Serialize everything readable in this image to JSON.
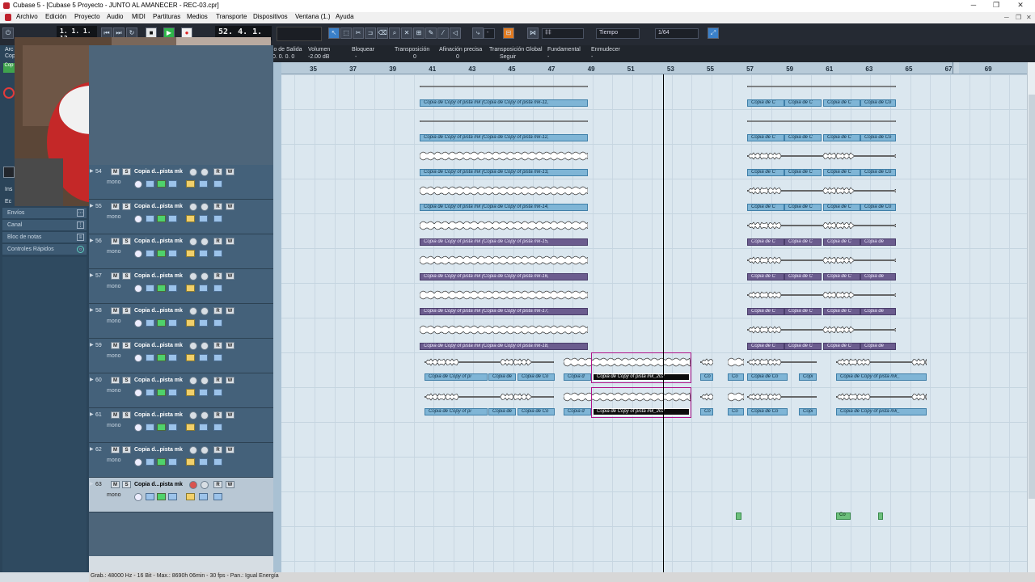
{
  "window": {
    "title": "Cubase 5 - [Cubase 5 Proyecto - JUNTO AL AMANECER - REC-03.cpr]",
    "controls": [
      "─",
      "❐",
      "✕"
    ]
  },
  "menubar": {
    "items": [
      "Archivo",
      "Edición",
      "Proyecto",
      "Audio",
      "MIDI",
      "Partituras",
      "Medios",
      "Transporte",
      "Dispositivos",
      "Ventana (1.)",
      "Ayuda"
    ]
  },
  "toolbar": {
    "position_left": "1. 1. 1. 13",
    "position_right": "52. 4. 1. 83",
    "snap_value": "Tiempo",
    "quantize": "1/64",
    "grid_glyph": "‡‡",
    "snap_dash": "-"
  },
  "infoline": {
    "labels": [
      "ido de Salida",
      "Volumen",
      "Bloquear",
      "Transposición",
      "Afinación precisa",
      "Transposición Global",
      "Fundamental",
      "Enmudecer"
    ],
    "values": [
      "0. 0. 0.   0",
      "-2.00 dB",
      "-",
      "0",
      "0",
      "Seguir",
      "-",
      "-"
    ]
  },
  "inspector": {
    "partial_labels": [
      "Arc",
      "Cop",
      "Ins",
      "Ec"
    ],
    "rows": [
      "Envíos",
      "Canal",
      "Bloc de notas",
      "Controles Rápidos"
    ]
  },
  "ruler": {
    "bars": [
      "35",
      "37",
      "39",
      "41",
      "43",
      "45",
      "47",
      "49",
      "51",
      "53",
      "55",
      "57",
      "59",
      "61",
      "63",
      "65",
      "67",
      "69"
    ]
  },
  "tracks": [
    {
      "number": "54",
      "name": "Copia d...pista mk",
      "mode": "mono",
      "mute": "M",
      "solo": "S",
      "read": "R",
      "write": "W",
      "stripe": "#2b2d3a"
    },
    {
      "number": "55",
      "name": "Copia d...pista mk",
      "mode": "mono",
      "mute": "M",
      "solo": "S",
      "read": "R",
      "write": "W",
      "stripe": "#2b2d3a"
    },
    {
      "number": "56",
      "name": "Copia d...pista mk",
      "mode": "mono",
      "mute": "M",
      "solo": "S",
      "read": "R",
      "write": "W",
      "stripe": "#2b2d3a"
    },
    {
      "number": "57",
      "name": "Copia d...pista mk",
      "mode": "mono",
      "mute": "M",
      "solo": "S",
      "read": "R",
      "write": "W",
      "stripe": "#2b2d3a"
    },
    {
      "number": "58",
      "name": "Copia d...pista mk",
      "mode": "mono",
      "mute": "M",
      "solo": "S",
      "read": "R",
      "write": "W",
      "stripe": "#62b9e6"
    },
    {
      "number": "59",
      "name": "Copia d...pista mk",
      "mode": "mono",
      "mute": "M",
      "solo": "S",
      "read": "R",
      "write": "W",
      "stripe": "#62b9e6"
    },
    {
      "number": "60",
      "name": "Copia d...pista mk",
      "mode": "mono",
      "mute": "M",
      "solo": "S",
      "read": "R",
      "write": "W",
      "stripe": "#e6d45a"
    },
    {
      "number": "61",
      "name": "Copia d...pista mk",
      "mode": "mono",
      "mute": "M",
      "solo": "S",
      "read": "R",
      "write": "W",
      "stripe": "#e6d45a"
    },
    {
      "number": "62",
      "name": "Copia d...pista mk",
      "mode": "mono",
      "mute": "M",
      "solo": "S",
      "read": "R",
      "write": "W",
      "stripe": "#5cbf7c"
    },
    {
      "number": "63",
      "name": "Copia d...pista mk",
      "mode": "mono",
      "mute": "M",
      "solo": "S",
      "read": "R",
      "write": "W",
      "stripe": "#5cbf7c"
    }
  ],
  "clips": {
    "upper_left": [
      "Copia de Copy of pista mk (Copia de Copy of pista mk-11,",
      "Copia de Copy of pista mk (Copia de Copy of pista mk-12,",
      "Copia de Copy of pista mk (Copia de Copy of pista mk-13,",
      "Copia de Copy of pista mk (Copia de Copy of pista mk-14,",
      "Copia de Copy of pista mk (Copia de Copy of pista mk-15,",
      "Copia de Copy of pista mk (Copia de Copy of pista mk-16,",
      "Copia de Copy of pista mk (Copia de Copy of pista mk-17,",
      "Copia de Copy of pista mk (Copia de Copy of pista mk-18,"
    ],
    "upper_right_blue": [
      "Copia de C",
      "Copia de C",
      "Copia de C",
      "Copia de Co"
    ],
    "upper_right_purple": [
      "Copia de C",
      "Copia de C",
      "Copia de C",
      "Copia de"
    ],
    "lane58": [
      "Copia de Copy of pi",
      "Copia de",
      "Copia de Co",
      "Copia d",
      "Copia de Copy of pista mk_202",
      "Co",
      "Co",
      "Copia de Co",
      "Copi",
      "Copia de Copy of pista mk_"
    ],
    "lane59": [
      "Copia de Copy of pi",
      "Copia de",
      "Copia de Co",
      "Copia d",
      "Copia de Copy of pista mk_202",
      "Co",
      "Co",
      "Copia de Co",
      "Copi",
      "Copia de Copy of pista mk_"
    ],
    "lane62": [
      "Co"
    ]
  },
  "status": {
    "text": "Grab.: 48000 Hz - 16 Bit - Max.: 8690h 06min - 30 fps - Pan.: Igual Energía"
  },
  "icons": {
    "app": "cubase-logo-icon",
    "play": "play-icon",
    "record": "record-icon",
    "stop": "stop-icon",
    "cycle": "cycle-icon",
    "pointer": "pointer-icon",
    "scissors": "scissors-icon"
  },
  "colors": {
    "toolbar_bg": "#252a33",
    "arrange_bg": "#dbe7ef",
    "clip_blue": "#7fb5d6",
    "clip_purple": "#6b5c8e",
    "selected_clip": "#0c0c0c",
    "track_header": "#44617a"
  }
}
